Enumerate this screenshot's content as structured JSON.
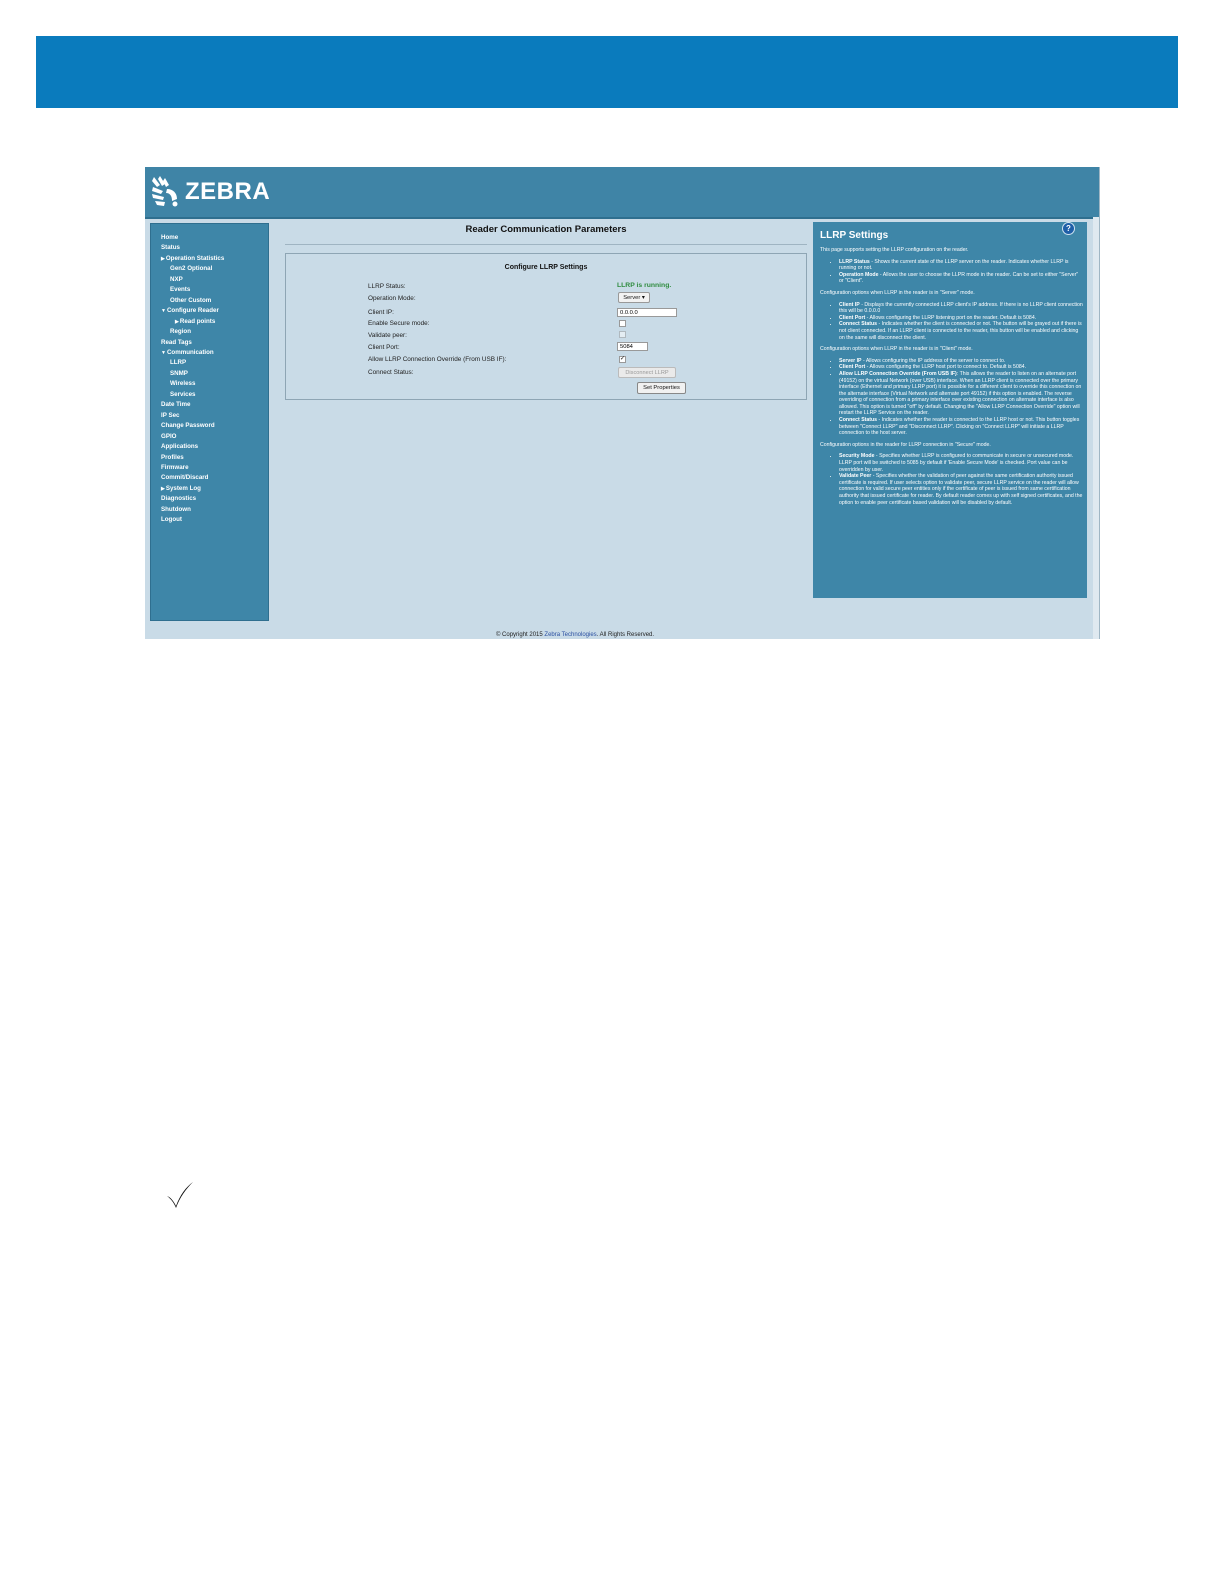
{
  "logo": {
    "text": "ZEBRA"
  },
  "sidebar": {
    "items": [
      {
        "label": "Home",
        "level": 0,
        "arrow": ""
      },
      {
        "label": "Status",
        "level": 0,
        "arrow": ""
      },
      {
        "label": "Operation Statistics",
        "level": 0,
        "arrow": "right"
      },
      {
        "label": "Gen2 Optional",
        "level": 1,
        "arrow": ""
      },
      {
        "label": "NXP",
        "level": 1,
        "arrow": ""
      },
      {
        "label": "Events",
        "level": 1,
        "arrow": ""
      },
      {
        "label": "Other Custom",
        "level": 1,
        "arrow": ""
      },
      {
        "label": "Configure Reader",
        "level": 0,
        "arrow": "down"
      },
      {
        "label": "Read points",
        "level": 2,
        "arrow": "right"
      },
      {
        "label": "Region",
        "level": 1,
        "arrow": ""
      },
      {
        "label": "Read Tags",
        "level": 0,
        "arrow": ""
      },
      {
        "label": "Communication",
        "level": 0,
        "arrow": "down"
      },
      {
        "label": "LLRP",
        "level": 1,
        "arrow": ""
      },
      {
        "label": "SNMP",
        "level": 1,
        "arrow": ""
      },
      {
        "label": "Wireless",
        "level": 1,
        "arrow": ""
      },
      {
        "label": "Services",
        "level": 1,
        "arrow": ""
      },
      {
        "label": "Date Time",
        "level": 0,
        "arrow": ""
      },
      {
        "label": "IP Sec",
        "level": 0,
        "arrow": ""
      },
      {
        "label": "Change Password",
        "level": 0,
        "arrow": ""
      },
      {
        "label": "GPIO",
        "level": 0,
        "arrow": ""
      },
      {
        "label": "Applications",
        "level": 0,
        "arrow": ""
      },
      {
        "label": "Profiles",
        "level": 0,
        "arrow": ""
      },
      {
        "label": "Firmware",
        "level": 0,
        "arrow": ""
      },
      {
        "label": "Commit/Discard",
        "level": 0,
        "arrow": ""
      },
      {
        "label": "System Log",
        "level": 0,
        "arrow": "right"
      },
      {
        "label": "Diagnostics",
        "level": 0,
        "arrow": ""
      },
      {
        "label": "Shutdown",
        "level": 0,
        "arrow": ""
      },
      {
        "label": "Logout",
        "level": 0,
        "arrow": ""
      }
    ]
  },
  "main": {
    "title": "Reader Communication Parameters",
    "config_heading": "Configure LLRP Settings",
    "labels": {
      "llrp_status": "LLRP Status:",
      "operation_mode": "Operation Mode:",
      "client_ip": "Client IP:",
      "enable_secure": "Enable Secure mode:",
      "validate_peer": "Validate peer:",
      "client_port": "Client Port:",
      "allow_override": "Allow LLRP Connection Override (From USB IF):",
      "connect_status": "Connect Status:"
    },
    "llrp_status_value": "LLRP is running.",
    "operation_mode_value": "Server ▾",
    "client_ip_value": "0.0.0.0",
    "client_port_value": "5084",
    "enable_secure_checked": false,
    "validate_peer_checked": false,
    "allow_override_checked": true,
    "checked_glyph": "✓",
    "disconnect_button": "Disconnect LLRP",
    "set_properties_button": "Set Properties"
  },
  "help": {
    "title": "LLRP Settings",
    "icon_label": "?",
    "intro": "This page supports setting the LLRP configuration on the reader.",
    "section1": [
      {
        "term": "LLRP Status",
        "text": " - Shows the current state of the LLRP server on the reader. Indicates whether LLRP is running or not."
      },
      {
        "term": "Operation Mode",
        "text": " - Allows the user to choose the LLPR mode in the reader. Can be set to either \"Server\" or \"Client\"."
      }
    ],
    "server_heading": "Configuration options when LLRP in the reader is in \"Server\" mode.",
    "server_items": [
      {
        "term": "Client IP",
        "text": " - Displays the currently connected LLRP client's IP address. If there is no LLRP client connection this will be 0.0.0.0"
      },
      {
        "term": "Client Port",
        "text": " - Allows configuring the LLRP listening port on the reader. Default is 5084."
      },
      {
        "term": "Connect Status",
        "text": " - Indicates whether the client is connected or not. The button will be grayed out if there is not client connected. If an LLRP client is connected to the reader, this button will be enabled and clicking on the same will disconnect the client."
      }
    ],
    "client_heading": "Configuration options when LLRP in the reader is in \"Client\" mode.",
    "client_items": [
      {
        "term": "Server IP",
        "text": " - Allows configuring the IP address of the server to connect to."
      },
      {
        "term": "Client Port",
        "text": " - Allows configuring the LLRP host port to connect to. Default is 5084."
      },
      {
        "term": "Allow LLRP Connection Override (From USB IF)",
        "text": ": This allows the reader to listen on an alternate port (49152) on the virtual Network (over USB) interface. When an LLRP client is connected over the primary interface (Ethernet and primary LLRP port) it is possible for a different client to override this connection on the alternate interface (Virtual Network and alternate port 49152) if this option is enabled. The reverse overriding of connection from a primary interface over existing connection on alternate interface is also allowed. This option is turned \"off\" by default. Changing the \"Allow LLRP Connection Override\" option will restart the LLRP Service on the reader."
      },
      {
        "term": "Connect Status",
        "text": " - Indicates whether the reader is connected to the LLRP host or not. This button toggles between \"Connect LLRP\" and \"Disconnect LLRP\". Clicking on \"Connect LLRP\" will initiate a LLRP connection to the host server."
      }
    ],
    "secure_heading": "Configuration options in the reader for LLRP connection in \"Secure\" mode.",
    "secure_items": [
      {
        "term": "Security Mode",
        "text": " - Specifies whether LLRP is configured to communicate in secure or unsecured mode. LLRP port will be switched to 5085 by default if 'Enable Secure Mode' is checked. Port value can be overridden by user."
      },
      {
        "term": "Validate Peer",
        "text": " - Specifies whether the validation of peer against the same certification authority issued certificate is required. If user selects option to validate peer, secure LLRP service on the reader will allow connection for valid secure peer entities only if the certificate of peer is issued from same certification authority that issued certificate for reader. By default reader comes up with self signed certificates, and the option to enable peer certificate based validation will be disabled by default."
      }
    ]
  },
  "footer": {
    "prefix": "© Copyright 2015 ",
    "link": "Zebra Technologies",
    "suffix": ". All Rights Reserved."
  },
  "colors": {
    "banner": "#0a7bbd",
    "panel": "#3e86a8",
    "status_green": "#2e8b3e"
  }
}
